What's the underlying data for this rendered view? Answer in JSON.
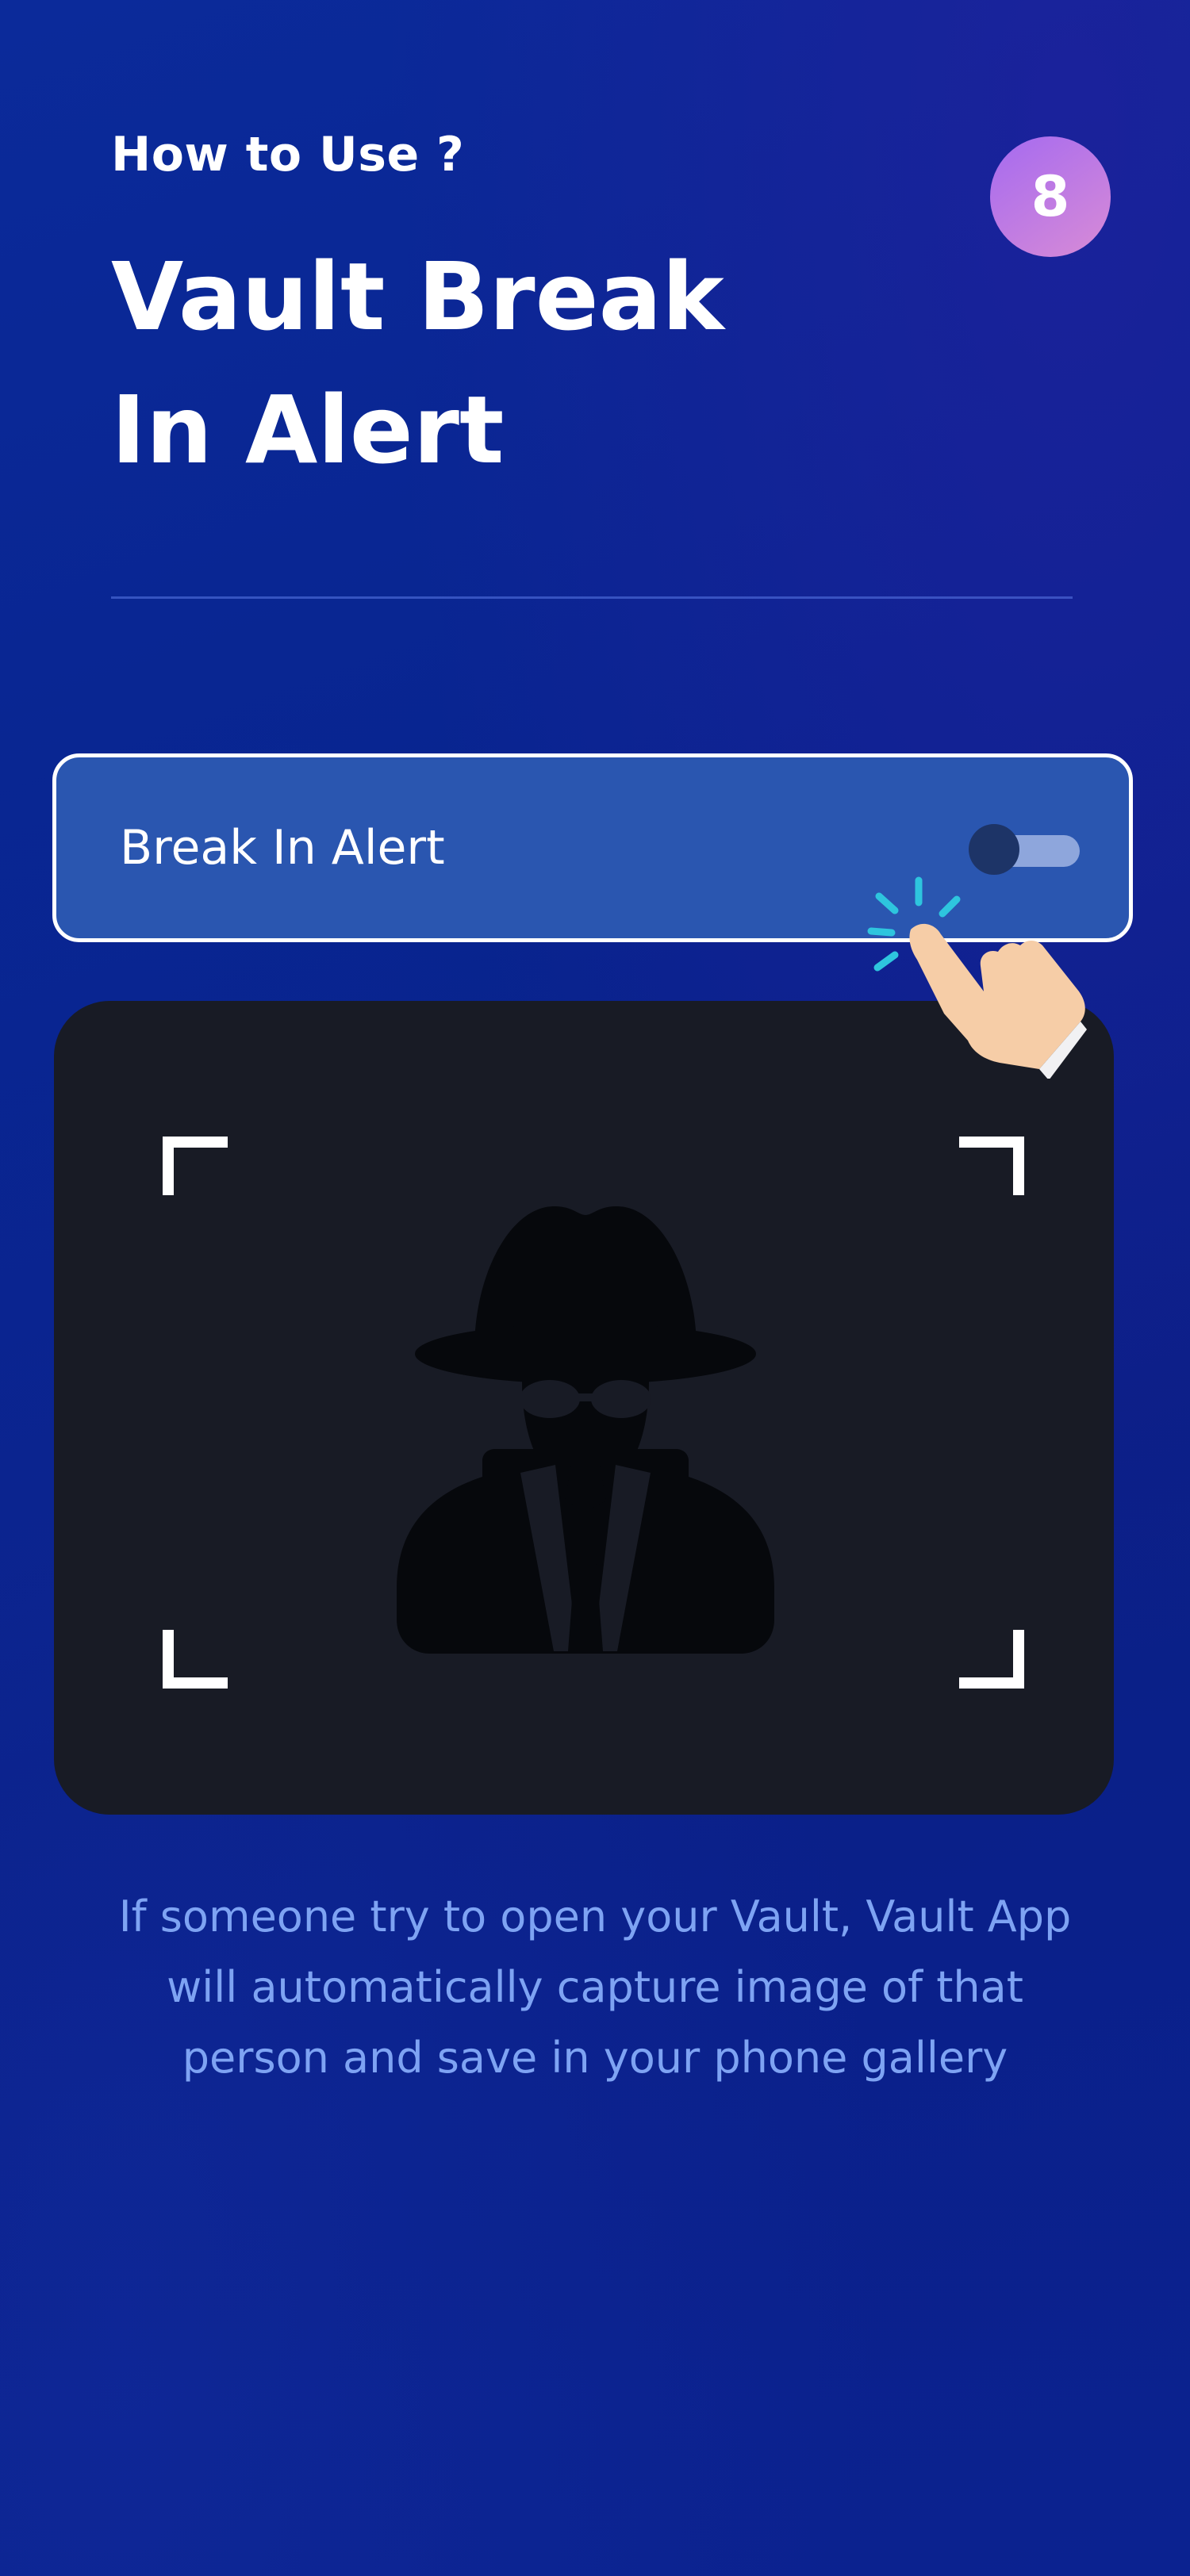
{
  "header": {
    "subtitle": "How to Use ?",
    "step_number": "8",
    "title": "Vault Break In Alert"
  },
  "alert_setting": {
    "label": "Break In Alert",
    "toggle_state": "off"
  },
  "description": "If someone try to open your Vault, Vault App will automatically capture image of that person and save in your phone gallery",
  "colors": {
    "background": "#0a2490",
    "card": "#2a56b0",
    "panel": "#181b25",
    "description_text": "#7ea3f3",
    "badge_start": "#a56af0",
    "badge_end": "#d88bd6"
  },
  "icons": [
    "spy-icon",
    "hand-pointer-icon",
    "tap-ripple-icon",
    "camera-frame-corner-icon"
  ]
}
